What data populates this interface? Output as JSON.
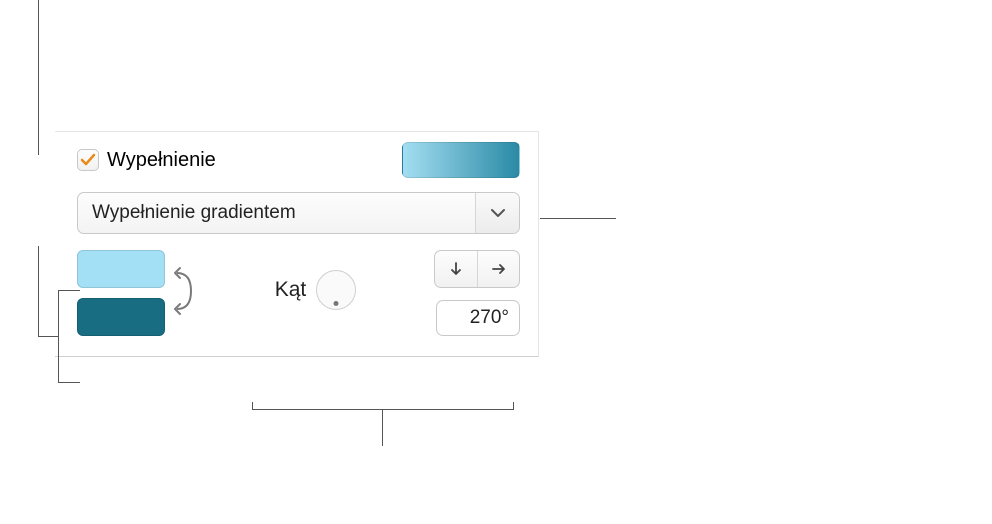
{
  "fill": {
    "checkbox_checked": true,
    "label": "Wypełnienie",
    "preview_gradient": [
      "#a4def2",
      "#2a8aa5"
    ],
    "type_dropdown": {
      "selected": "Wypełnienie gradientem"
    },
    "gradient_colors": {
      "color1": "#a4e0f5",
      "color2": "#186d83",
      "swap_icon": "swap-icon"
    },
    "angle": {
      "label": "Kąt",
      "value_display": "270°",
      "value": 270,
      "direction_buttons": {
        "down": "arrow-down",
        "right": "arrow-right"
      }
    }
  }
}
